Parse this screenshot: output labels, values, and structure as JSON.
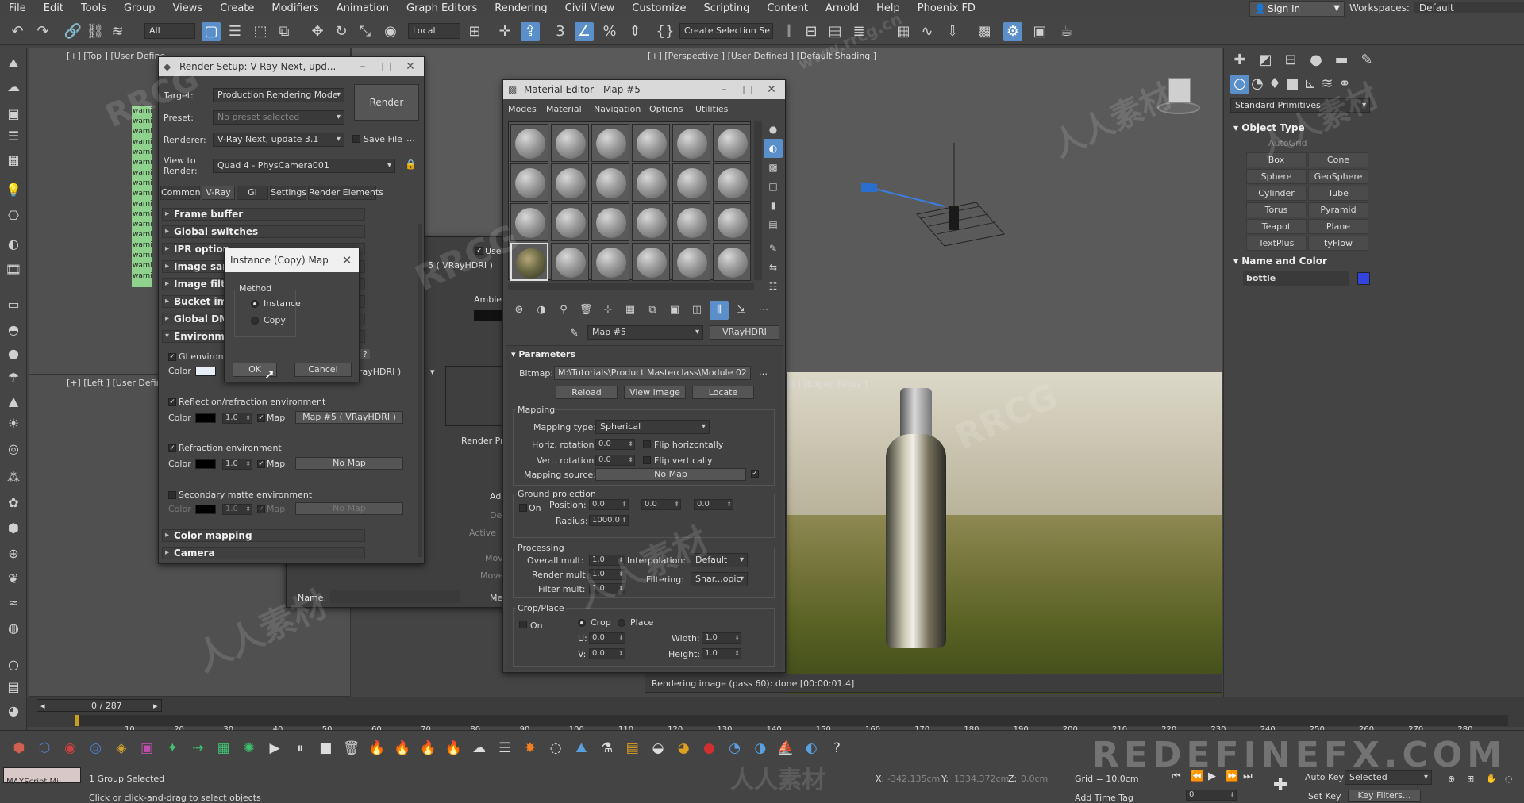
{
  "menu": [
    "File",
    "Edit",
    "Tools",
    "Group",
    "Views",
    "Create",
    "Modifiers",
    "Animation",
    "Graph Editors",
    "Rendering",
    "Civil View",
    "Customize",
    "Scripting",
    "Content",
    "Arnold",
    "Help",
    "Phoenix FD"
  ],
  "signin": "Sign In",
  "workspaces": {
    "label": "Workspaces:",
    "value": "Default"
  },
  "toolbar": {
    "filter": "All",
    "coord": "Local",
    "selection_set": "Create Selection Se"
  },
  "viewports": {
    "top": "[+] [Top ] [User Define",
    "perspective": "[+] [Perspective ] [User Defined ] [Default Shading ]",
    "left": "[+] [Left ] [User Define",
    "camera": "d ] [Edged Faces ]",
    "render_status": "Rendering image (pass 60): done [00:00:01.4]"
  },
  "command_panel": {
    "category": "Standard Primitives",
    "object_type_title": "Object Type",
    "autogrid": "AutoGrid",
    "buttons": [
      "Box",
      "Cone",
      "Sphere",
      "GeoSphere",
      "Cylinder",
      "Tube",
      "Torus",
      "Pyramid",
      "Teapot",
      "Plane",
      "TextPlus",
      "tyFlow"
    ],
    "name_color_title": "Name and Color",
    "object_name": "bottle",
    "object_color": "#3344dd"
  },
  "render_setup": {
    "title": "Render Setup: V-Ray Next, upd...",
    "target_label": "Target:",
    "target": "Production Rendering Mode",
    "preset_label": "Preset:",
    "preset": "No preset selected",
    "renderer_label": "Renderer:",
    "renderer": "V-Ray Next, update 3.1",
    "save_file": "Save File",
    "view_label": "View to Render:",
    "view": "Quad 4 - PhysCamera001",
    "render_btn": "Render",
    "tabs": [
      "Common",
      "V-Ray",
      "GI",
      "Settings",
      "Render Elements"
    ],
    "rollouts": [
      "Frame buffer",
      "Global switches",
      "IPR option",
      "Image sam",
      "Image filte",
      "Bucket ima",
      "Global DMC",
      "Environme"
    ],
    "gi_env": "GI environm",
    "color_label": "Color",
    "refl_env": "Reflection/refraction environment",
    "refl_mult": "1.0",
    "map_label": "Map",
    "refl_map": "Map #5 ( VRayHDRI )",
    "refr_env": "Refraction environment",
    "refr_mult": "1.0",
    "refr_map": "No Map",
    "sec_matte": "Secondary matte environment",
    "sec_mult": "1.0",
    "sec_map": "No Map",
    "color_mapping": "Color mapping",
    "camera": "Camera",
    "partial_map": "rayHDRI )",
    "question": "?"
  },
  "instance_dialog": {
    "title": "Instance (Copy) Map",
    "method": "Method",
    "options": [
      "Instance",
      "Copy"
    ],
    "ok": "OK",
    "cancel": "Cancel"
  },
  "bg_window": {
    "use_label": "Use l",
    "map_text": "5 ( VRayHDRI )",
    "ambient": "Ambien",
    "render_pre": "Render Pre",
    "add": "Add",
    "del": "Del",
    "active": "Active",
    "move1": "Mov",
    "move2": "Move",
    "name_label": "Name:",
    "mer": "Me"
  },
  "material_editor": {
    "title": "Material Editor - Map #5",
    "menu": [
      "Modes",
      "Material",
      "Navigation",
      "Options",
      "Utilities"
    ],
    "map_name": "Map #5",
    "map_type": "VRayHDRI",
    "params_title": "Parameters",
    "bitmap_label": "Bitmap:",
    "bitmap_path": "M:\\Tutorials\\Product Masterclass\\Module 02 - Ligh",
    "reload": "Reload",
    "view_image": "View image",
    "locate": "Locate",
    "mapping": "Mapping",
    "mapping_type_label": "Mapping type:",
    "mapping_type": "Spherical",
    "horiz_label": "Horiz. rotation:",
    "horiz": "0.0",
    "flip_h": "Flip horizontally",
    "vert_label": "Vert. rotation:",
    "vert": "0.0",
    "flip_v": "Flip vertically",
    "mapping_source_label": "Mapping source:",
    "mapping_source": "No Map",
    "ground": "Ground projection",
    "on": "On",
    "position_label": "Position:",
    "pos": [
      "0.0",
      "0.0",
      "0.0"
    ],
    "radius_label": "Radius:",
    "radius": "1000.0",
    "processing": "Processing",
    "overall_label": "Overall mult:",
    "overall": "1.0",
    "interp_label": "Interpolation:",
    "interp": "Default",
    "render_mult_label": "Render mult:",
    "render_mult": "1.0",
    "filtering_label": "Filtering:",
    "filtering": "Shar...opic",
    "filter_mult_label": "Filter mult:",
    "filter_mult": "1.0",
    "crop_place": "Crop/Place",
    "crop": "Crop",
    "place": "Place",
    "u_label": "U:",
    "u": "0.0",
    "v_label": "V:",
    "v": "0.0",
    "width_label": "Width:",
    "width": "1.0",
    "height_label": "Height:",
    "height": "1.0"
  },
  "timeline": {
    "frame": "0 / 287",
    "ticks": [
      "10",
      "20",
      "30",
      "40",
      "50",
      "60",
      "70",
      "80",
      "90",
      "100",
      "110",
      "120",
      "130",
      "140",
      "150",
      "160",
      "170",
      "180",
      "190",
      "200",
      "210",
      "220",
      "230",
      "240",
      "250",
      "260",
      "270",
      "280"
    ]
  },
  "status": {
    "selected": "1 Group Selected",
    "prompt": "Click or click-and-drag to select objects",
    "script": "MAXScript Mi:",
    "x_label": "X:",
    "x": "-342.135cm",
    "y_label": "Y:",
    "y": "1334.372cm",
    "z_label": "Z:",
    "z": "0.0cm",
    "grid": "Grid = 10.0cm",
    "add_time_tag": "Add Time Tag",
    "auto_key": "Auto Key",
    "auto_key_sel": "Selected",
    "set_key": "Set Key",
    "key_filters": "Key Filters...",
    "frame_field": "0"
  },
  "watermarks": [
    "RRCG",
    "人人素材",
    "REDEFINEFX.COM",
    "www.rrcg.cn"
  ]
}
